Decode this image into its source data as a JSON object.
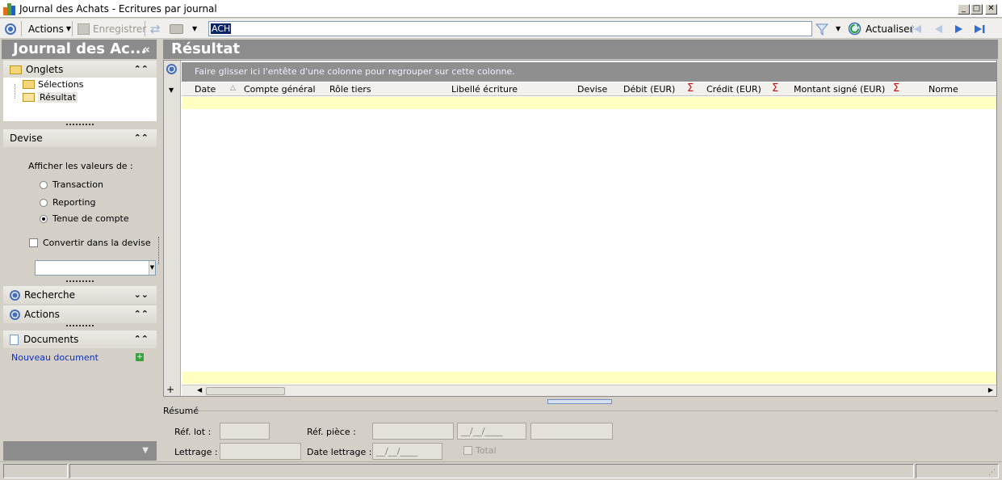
{
  "window": {
    "title": "Journal des Achats - Ecritures par journal",
    "minimize": "_",
    "maximize": "□",
    "close": "✕"
  },
  "toolbar": {
    "actions_label": "Actions",
    "save_label": "Enregistrer",
    "search_value": "ACH",
    "refresh_label": "Actualiser"
  },
  "left_panel": {
    "title": "Journal des Ac...",
    "collapse_glyph": "«",
    "tabs_section": {
      "label": "Onglets",
      "items": [
        {
          "label": "Sélections"
        },
        {
          "label": "Résultat"
        }
      ]
    },
    "currency_section": {
      "label": "Devise",
      "show_values_label": "Afficher les valeurs de :",
      "options": [
        {
          "label": "Transaction",
          "checked": false
        },
        {
          "label": "Reporting",
          "checked": false
        },
        {
          "label": "Tenue de compte",
          "checked": true
        }
      ],
      "convert_label": "Convertir dans la devise",
      "convert_checked": false,
      "currency_value": ""
    },
    "search_section": {
      "label": "Recherche"
    },
    "actions_section": {
      "label": "Actions"
    },
    "documents_section": {
      "label": "Documents",
      "new_document": "Nouveau document"
    }
  },
  "main": {
    "title": "Résultat",
    "group_hint": "Faire glisser ici l'entête d'une colonne pour regrouper sur cette colonne.",
    "columns": [
      "Date",
      "Compte général",
      "Rôle tiers",
      "Libellé écriture",
      "Devise",
      "Débit (EUR)",
      "Crédit (EUR)",
      "Montant signé (EUR)",
      "Norme"
    ],
    "sigma": "Σ",
    "add_glyph": "+"
  },
  "summary": {
    "title": "Résumé",
    "lot_ref_label": "Réf. lot :",
    "lot_ref_value": "",
    "piece_ref_label": "Réf. pièce :",
    "piece_ref_value": "",
    "piece_date_value": "__/__/____",
    "piece_extra_value": "",
    "lettering_label": "Lettrage :",
    "lettering_value": "",
    "lettering_date_label": "Date lettrage :",
    "lettering_date_value": "__/__/____",
    "total_label": "Total",
    "total_checked": false
  },
  "colors": {
    "header_gray": "#8c8c8c",
    "accent_blue": "#4a6fb5",
    "row_yellow": "#ffffc0",
    "sigma_red": "#c01010"
  }
}
